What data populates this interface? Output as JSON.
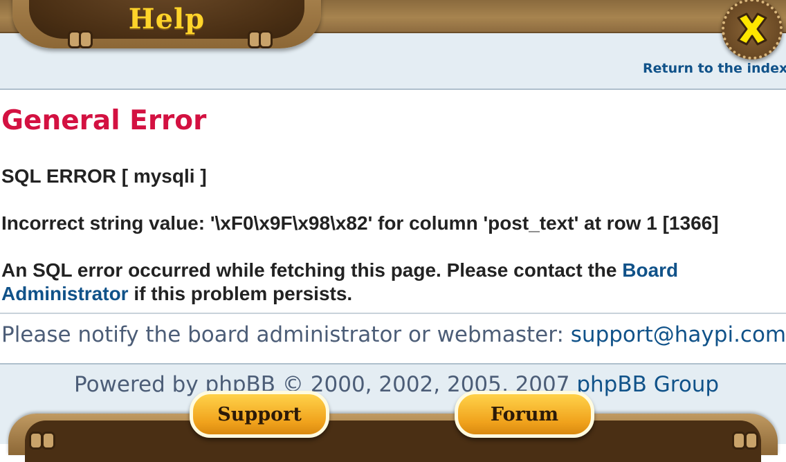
{
  "header": {
    "title": "Help",
    "close_icon": "close-x-icon",
    "return_link": "Return to the index"
  },
  "error": {
    "title": "General Error",
    "sql_error": "SQL ERROR [ mysqli ]",
    "detail": "Incorrect string value: '\\xF0\\x9F\\x98\\x82' for column 'post_text' at row 1 [1366]",
    "occurred_text": "An SQL error occurred while fetching this page. Please contact the",
    "board_link": "Board",
    "admin_link": "Administrator",
    "persists_text": " if this problem persists."
  },
  "notify": {
    "text": "Please notify the board administrator or webmaster: ",
    "email": "support@haypi.com"
  },
  "footer": {
    "powered_prefix": "Powered by ",
    "powered_link": "phpBB",
    "powered_middle": " © 2000, 2002, 2005, 2007 ",
    "group_link": "phpBB Group",
    "support_button": "Support",
    "forum_button": "Forum"
  },
  "colors": {
    "error_title": "#d31141",
    "link": "#105289",
    "button": "#f0a21c",
    "wood": "#8c6736"
  }
}
